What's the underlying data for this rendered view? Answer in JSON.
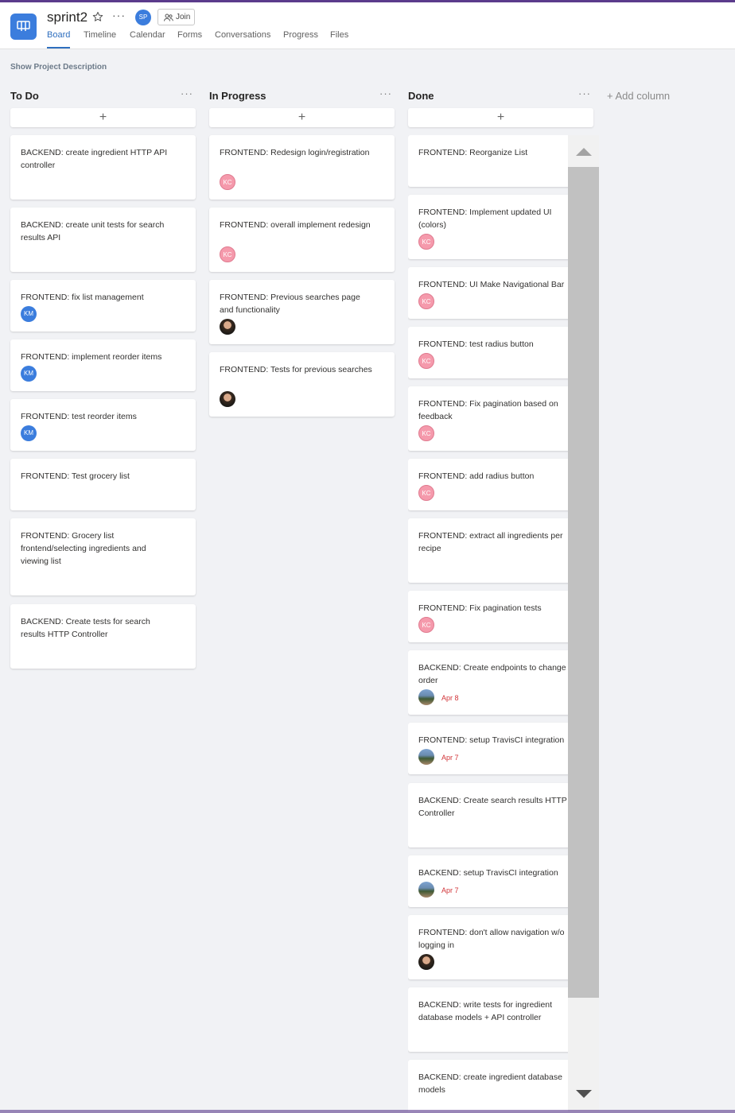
{
  "header": {
    "title": "sprint2",
    "avatar_initials": "SP",
    "join_label": "Join",
    "tabs": [
      "Board",
      "Timeline",
      "Calendar",
      "Forms",
      "Conversations",
      "Progress",
      "Files"
    ],
    "active_tab": "Board"
  },
  "description_link": "Show Project Description",
  "add_column_label": "+ Add column",
  "columns": [
    {
      "name": "To Do",
      "add_symbol": "+",
      "cards": [
        {
          "title": "BACKEND: create ingredient HTTP API controller",
          "assignee": ""
        },
        {
          "title": "BACKEND: create unit tests for search results API",
          "assignee": ""
        },
        {
          "title": "FRONTEND: fix list management",
          "assignee": "KM"
        },
        {
          "title": "FRONTEND: implement reorder items",
          "assignee": "KM"
        },
        {
          "title": "FRONTEND: test reorder items",
          "assignee": "KM"
        },
        {
          "title": "FRONTEND: Test grocery list",
          "assignee": ""
        },
        {
          "title": "FRONTEND: Grocery list frontend/selecting ingredients and viewing list",
          "assignee": ""
        },
        {
          "title": "BACKEND: Create tests for search results HTTP Controller",
          "assignee": ""
        }
      ]
    },
    {
      "name": "In Progress",
      "add_symbol": "+",
      "cards": [
        {
          "title": "FRONTEND: Redesign login/registration",
          "assignee": "KC"
        },
        {
          "title": "FRONTEND: overall implement redesign",
          "assignee": "KC"
        },
        {
          "title": "FRONTEND: Previous searches page and functionality",
          "assignee": "photo"
        },
        {
          "title": "FRONTEND: Tests for previous searches",
          "assignee": "photo"
        }
      ]
    },
    {
      "name": "Done",
      "add_symbol": "+",
      "cards": [
        {
          "title": "FRONTEND: Reorganize List",
          "assignee": ""
        },
        {
          "title": "FRONTEND: Implement updated UI (colors)",
          "assignee": "KC"
        },
        {
          "title": "FRONTEND: UI Make Navigational Bar",
          "assignee": "KC"
        },
        {
          "title": "FRONTEND: test radius button",
          "assignee": "KC"
        },
        {
          "title": "FRONTEND: Fix pagination based on feedback",
          "assignee": "KC"
        },
        {
          "title": "FRONTEND: add radius button",
          "assignee": "KC"
        },
        {
          "title": "FRONTEND: extract all ingredients per recipe",
          "assignee": ""
        },
        {
          "title": "FRONTEND: Fix pagination tests",
          "assignee": "KC"
        },
        {
          "title": "BACKEND: Create endpoints to change order",
          "assignee": "photo2",
          "due": "Apr 8"
        },
        {
          "title": "FRONTEND: setup TravisCI integration",
          "assignee": "photo2",
          "due": "Apr 7"
        },
        {
          "title": "BACKEND: Create search results HTTP Controller",
          "assignee": ""
        },
        {
          "title": "BACKEND: setup TravisCI integration",
          "assignee": "photo2",
          "due": "Apr 7"
        },
        {
          "title": "FRONTEND: don't allow navigation w/o logging in",
          "assignee": "photo"
        },
        {
          "title": "BACKEND: write tests for ingredient database models + API controller",
          "assignee": ""
        },
        {
          "title": "BACKEND: create ingredient database models",
          "assignee": ""
        }
      ]
    }
  ],
  "colors": {
    "accent": "#2f6fbf",
    "app_icon": "#3b7ddd",
    "kc_avatar": "#f59aac",
    "km_avatar": "#3b7ddd",
    "due_date": "#d13438",
    "board_bg": "#f1f2f5"
  }
}
